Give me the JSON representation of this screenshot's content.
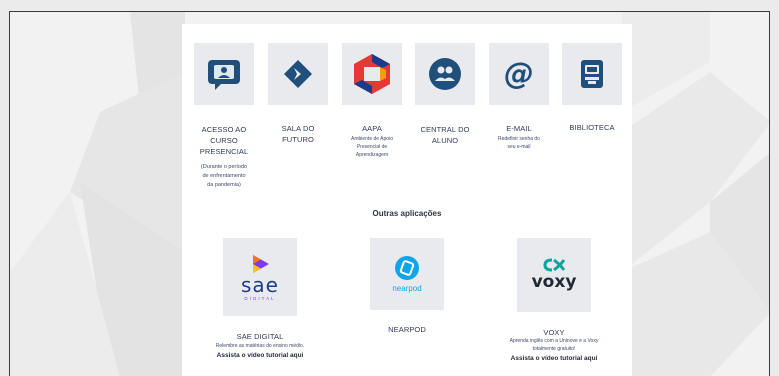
{
  "apps": [
    {
      "name": "acesso",
      "label_lines": [
        "ACESSO AO",
        "CURSO",
        "PRESENCIAL"
      ],
      "sub_lines": [
        "(Durante o período",
        "de enfrentamento",
        "da pandemia)"
      ],
      "icon": "video-chat-icon",
      "color": "#1f4f7a"
    },
    {
      "name": "sala",
      "label_lines": [
        "SALA DO",
        "FUTURO"
      ],
      "sub_lines": [],
      "icon": "diamond-arrow-icon",
      "color": "#1f4f7a"
    },
    {
      "name": "aapa",
      "label_lines": [
        "AAPA"
      ],
      "sub_lines": [
        "Ambiente de Apoio",
        "Presencial de",
        "Aprendizagem"
      ],
      "icon": "aapa-logo-icon",
      "color": "#e53935"
    },
    {
      "name": "central",
      "label_lines": [
        "CENTRAL DO",
        "ALUNO"
      ],
      "sub_lines": [],
      "icon": "group-icon",
      "color": "#1f4f7a"
    },
    {
      "name": "email",
      "label_lines": [
        "E-MAIL"
      ],
      "sub_lines": [
        "Redefinir senha do",
        "seu e-mail"
      ],
      "icon": "at-sign-icon",
      "color": "#1f4f7a"
    },
    {
      "name": "biblioteca",
      "label_lines": [
        "BIBLIOTECA"
      ],
      "sub_lines": [],
      "icon": "library-icon",
      "color": "#1f4f7a"
    }
  ],
  "section_title": "Outras aplicações",
  "other_apps": [
    {
      "name": "sae",
      "logo_text": "sae",
      "logo_sub": "DIGITAL",
      "label": "SAE DIGITAL",
      "sub": "Relembre as matérias do ensino médio.",
      "link": "Assista o vídeo tutorial aqui",
      "icon": "sae-play-icon"
    },
    {
      "name": "nearpod",
      "logo_text": "nearpod",
      "label": "NEARPOD",
      "sub": "",
      "link": "",
      "icon": "nearpod-icon"
    },
    {
      "name": "voxy",
      "logo_text": "voxy",
      "label": "VOXY",
      "sub_lines": [
        "Aprenda inglês com a Uninove e a Voxy",
        "totalmente gratuito!"
      ],
      "link": "Assista o vídeo tutorial aqui",
      "icon": "voxy-icon"
    }
  ]
}
